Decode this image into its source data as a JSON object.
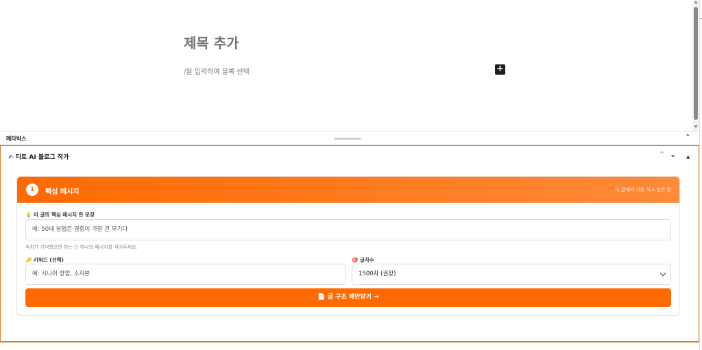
{
  "editor": {
    "title_placeholder": "제목 추가",
    "block_hint": "/을 입력하여 블록 선택",
    "inserter_glyph": "+"
  },
  "metabox_bar": {
    "title": "메타박스",
    "toggle_glyph": "⌃"
  },
  "plugin": {
    "icon": "✍",
    "title": "티토 AI 블로그 작가",
    "controls": {
      "move_up": "⌃",
      "move_down": "⌄",
      "toggle": "▲"
    },
    "step_card": {
      "step_number": "1",
      "title": "핵심 메시지",
      "subtitle": "이 글에서 가장 하고 싶은 말",
      "message_field": {
        "label_icon": "💡",
        "label": "이 글의 핵심 메시지 한 문장",
        "placeholder": "예: 50대 창업은 경험이 가장 큰 무기다",
        "help": "독자가 기억했으면 하는 단 하나의 메시지를 적어주세요."
      },
      "keyword_field": {
        "label_icon": "🔑",
        "label": "키워드 (선택)",
        "placeholder": "예: 시니어 창업, 소자본"
      },
      "length_field": {
        "label_icon": "🎯",
        "label": "글자수",
        "selected": "1500자 (권장)"
      },
      "submit": {
        "icon": "📄",
        "label": "글 구조 제안받기 →"
      }
    }
  },
  "colors": {
    "accent": "#ff6a00",
    "accent_light": "#ff8a3a",
    "border": "#e07a1f"
  }
}
